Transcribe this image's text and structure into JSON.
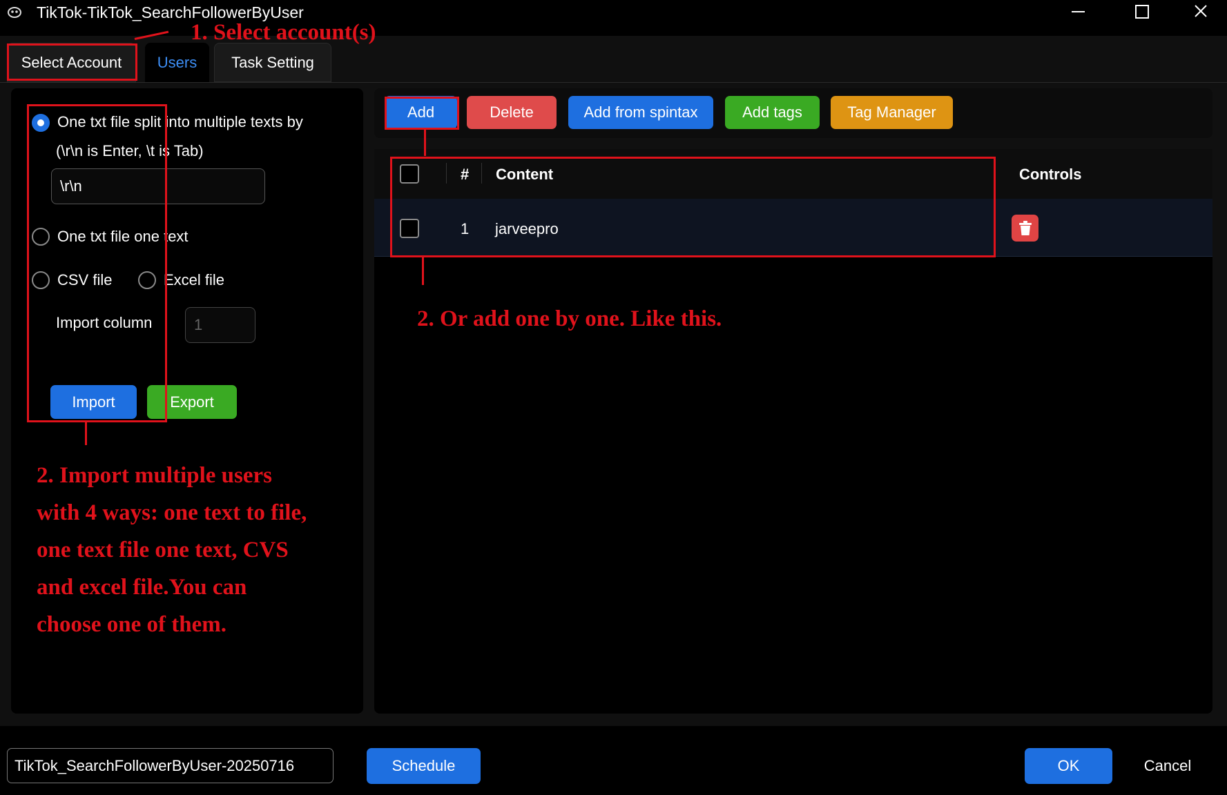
{
  "window": {
    "title": "TikTok-TikTok_SearchFollowerByUser",
    "icon": "app-logo-icon",
    "controls": [
      "minimize-icon",
      "maximize-icon",
      "close-icon"
    ]
  },
  "tabs": [
    {
      "label": "Select Account",
      "active": false
    },
    {
      "label": "Users",
      "active": true
    },
    {
      "label": "Task Setting",
      "active": false
    }
  ],
  "import_panel": {
    "option_split_label_line1": "One txt file split into multiple texts by",
    "option_split_label_line2": "(\\r\\n is Enter, \\t is Tab)",
    "split_value": "\\r\\n",
    "option_one_text_label": "One txt file one text",
    "option_csv_label": "CSV file",
    "option_excel_label": "Excel file",
    "selected_option": "split",
    "import_column_label": "Import column",
    "import_column_placeholder": "1",
    "import_label": "Import",
    "export_label": "Export"
  },
  "toolbar": {
    "add_label": "Add",
    "delete_label": "Delete",
    "spintax_label": "Add from spintax",
    "tags_label": "Add tags",
    "tag_manager_label": "Tag Manager"
  },
  "grid": {
    "columns": [
      "#",
      "Content",
      "Controls"
    ],
    "rows": [
      {
        "index": "1",
        "content": "jarveepro"
      }
    ]
  },
  "bottom": {
    "task_name": "TikTok_SearchFollowerByUser-20250716",
    "schedule_label": "Schedule",
    "ok_label": "OK",
    "cancel_label": "Cancel"
  },
  "annotations": {
    "step1": "1. Select account(s)",
    "step2_add": "2. Or add one by one. Like this.",
    "step2_import_lines": [
      "2. Import multiple users",
      "with 4 ways: one text to file,",
      "one text file one text, CVS",
      "and excel file.You can",
      "choose one of them."
    ]
  },
  "colors": {
    "primary": "#1e6fe0",
    "danger": "#df4b4b",
    "success": "#3aaa23",
    "warning": "#de9413",
    "annotation": "#e0121b"
  }
}
